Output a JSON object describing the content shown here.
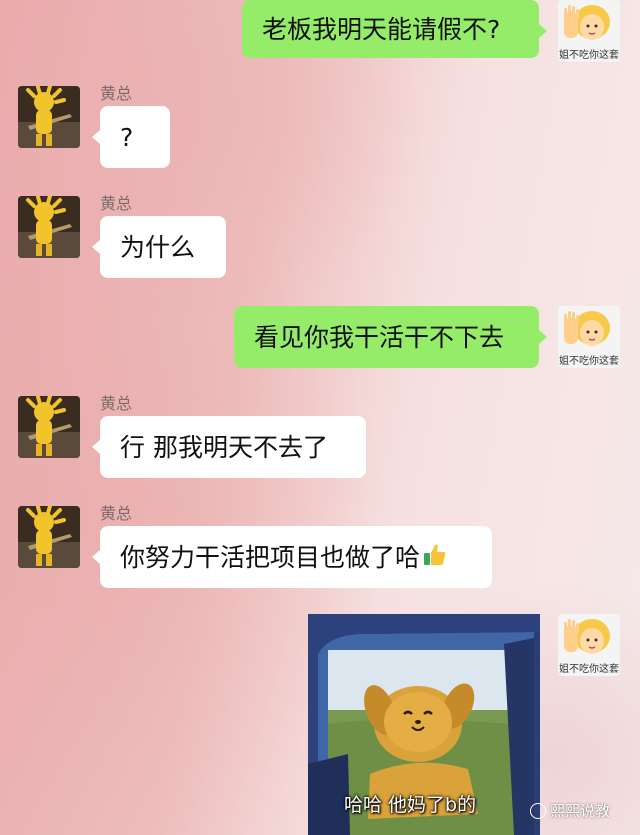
{
  "contact_name": "黄总",
  "messages": [
    {
      "side": "right",
      "text": "老板我明天能请假不?"
    },
    {
      "side": "left",
      "sender": "黄总",
      "text": "?"
    },
    {
      "side": "left",
      "sender": "黄总",
      "text": "为什么"
    },
    {
      "side": "right",
      "text": "看见你我干活干不下去"
    },
    {
      "side": "left",
      "sender": "黄总",
      "text": "行 那我明天不去了"
    },
    {
      "side": "left",
      "sender": "黄总",
      "text": "你努力干活把项目也做了哈"
    },
    {
      "side": "right",
      "type": "sticker",
      "caption": "哈哈 他妈了b的"
    }
  ],
  "my_avatar": {
    "icon": "raised-hand-girl-emoji",
    "caption": "姐不吃你这套"
  },
  "contact_avatar": {
    "icon": "yellow-figure-avatar"
  },
  "thumbs_up_icon": "thumbs-up-icon",
  "watermark": {
    "icon": "weibo-icon",
    "text": "熙熙说教"
  },
  "colors": {
    "my_bubble": "#95ec69",
    "their_bubble": "#ffffff"
  }
}
